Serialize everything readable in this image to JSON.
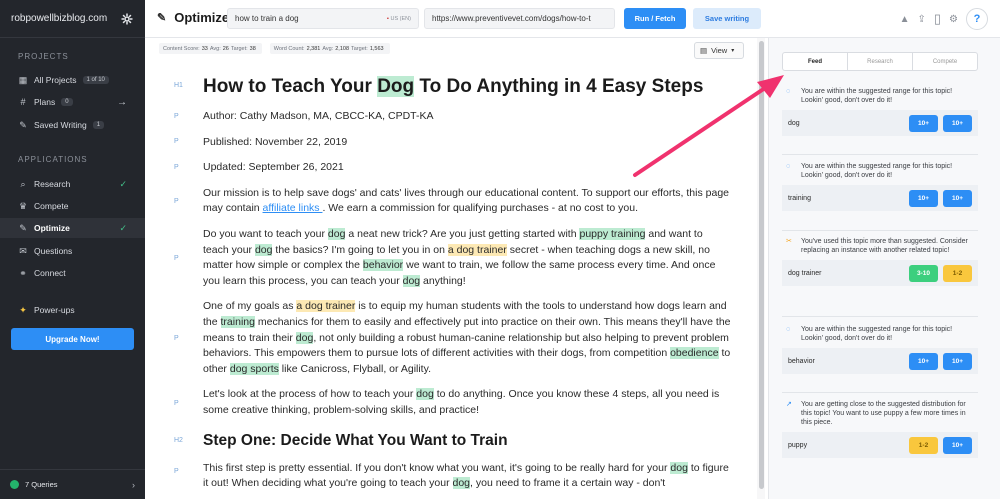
{
  "sidebar": {
    "brand": "robpowellbizblog.com",
    "projects_heading": "PROJECTS",
    "applications_heading": "APPLICATIONS",
    "projects_items": [
      {
        "label": "All Projects",
        "count": "1 of 10",
        "icon": "grid-icon"
      },
      {
        "label": "Plans",
        "count": "0",
        "icon": "hash-icon"
      },
      {
        "label": "Saved Writing",
        "count": "1",
        "icon": "edit-icon"
      }
    ],
    "app_items": [
      {
        "label": "Research",
        "icon": "search-icon",
        "checked": true
      },
      {
        "label": "Compete",
        "icon": "trophy-icon",
        "checked": false
      },
      {
        "label": "Optimize",
        "icon": "edit-icon",
        "checked": true,
        "active": true
      },
      {
        "label": "Questions",
        "icon": "chat-icon",
        "checked": false
      },
      {
        "label": "Connect",
        "icon": "link-icon",
        "checked": false
      }
    ],
    "powerups_label": "Power-ups",
    "upgrade_label": "Upgrade Now!",
    "queries_label": "7 Queries"
  },
  "topbar": {
    "title": "Optimize",
    "search_value": "how to train a dog",
    "search_locale": "US (EN)",
    "url_value": "https://www.preventivevet.com/dogs/how-to-t",
    "run_label": "Run / Fetch",
    "save_label": "Save writing"
  },
  "editor": {
    "stats": {
      "score_label": "Content Score:",
      "score_value": "33",
      "score_avg_label": "Avg:",
      "score_avg": "26",
      "score_target_label": "Target:",
      "score_target": "38",
      "wc_label": "Word Count:",
      "wc_value": "2,381",
      "wc_avg_label": "Avg:",
      "wc_avg": "2,108",
      "wc_target_label": "Target:",
      "wc_target": "1,563"
    },
    "view_label": "View",
    "tags": [
      "H1",
      "P",
      "P",
      "P",
      "P",
      "P",
      "P",
      "P",
      "H2",
      "P"
    ],
    "h1": {
      "pre": "How to Teach Your ",
      "hl": "Dog",
      "post": " To Do Anything in 4 Easy Steps"
    },
    "author": "Author: Cathy Madson, MA, CBCC-KA, CPDT-KA",
    "published": "Published: November 22, 2019",
    "updated": "Updated: September 26, 2021",
    "p1": {
      "pre": "Our mission is to help save dogs' and cats' lives through our educational content. To support our efforts, this page may contain ",
      "link": "affiliate links ",
      "post": ". We earn a commission for qualifying purchases - at no cost to you."
    },
    "p2": [
      {
        "t": "Do you want to teach your "
      },
      {
        "t": "dog",
        "h": "g"
      },
      {
        "t": " a neat new trick? Are you just getting started with "
      },
      {
        "t": "puppy training",
        "h": "g"
      },
      {
        "t": " and want to teach your "
      },
      {
        "t": "dog",
        "h": "g"
      },
      {
        "t": " the basics? I'm going to let you in on "
      },
      {
        "t": "a dog trainer",
        "h": "y"
      },
      {
        "t": " secret - when teaching dogs a new skill, no matter how simple or complex the "
      },
      {
        "t": "behavior",
        "h": "g"
      },
      {
        "t": " we want to train, we follow the same process every time. And once you learn this process, you can teach your "
      },
      {
        "t": "dog",
        "h": "g"
      },
      {
        "t": " anything!"
      }
    ],
    "p3": [
      {
        "t": "One of my goals as "
      },
      {
        "t": "a dog trainer",
        "h": "y"
      },
      {
        "t": " is to equip my human students with the tools to understand how dogs learn and the "
      },
      {
        "t": "training",
        "h": "g"
      },
      {
        "t": " mechanics for them to easily and effectively put into practice on their own. This means they'll have the means to train their "
      },
      {
        "t": "dog",
        "h": "g"
      },
      {
        "t": ", not only building a robust human-canine relationship but also helping to prevent problem behaviors. This empowers them to pursue lots of different activities with their dogs, from competition "
      },
      {
        "t": "obedience",
        "h": "g"
      },
      {
        "t": " to other "
      },
      {
        "t": "dog sports",
        "h": "g"
      },
      {
        "t": " like Canicross, Flyball, or Agility."
      }
    ],
    "p4": [
      {
        "t": "Let's look at the process of how to teach your "
      },
      {
        "t": "dog",
        "h": "g"
      },
      {
        "t": " to do anything. Once you know these 4 steps, all you need is some creative thinking, problem-solving skills, and practice!"
      }
    ],
    "h2": "Step One: Decide What You Want to Train",
    "p5": [
      {
        "t": "This first step is pretty essential. If you don't know what you want, it's going to be really hard for your "
      },
      {
        "t": "dog",
        "h": "g"
      },
      {
        "t": " to figure it out! When deciding what you're going to teach your "
      },
      {
        "t": "dog",
        "h": "g"
      },
      {
        "t": ", you need to frame it a certain way - don't"
      }
    ]
  },
  "panel": {
    "tabs": [
      "Feed",
      "Research",
      "Compete"
    ],
    "cards": [
      {
        "msg": "You are within the suggested range for this topic! Lookin' good, don't over do it!",
        "term": "dog",
        "b1": "10+",
        "b1c": "blue",
        "b2": "10+",
        "b2c": "blue",
        "icon": "check-circle-icon"
      },
      {
        "msg": "You are within the suggested range for this topic! Lookin' good, don't over do it!",
        "term": "training",
        "b1": "10+",
        "b1c": "blue",
        "b2": "10+",
        "b2c": "blue",
        "icon": "check-circle-icon"
      },
      {
        "msg": "You've used this topic more than suggested. Consider replacing an instance with another related topic!",
        "term": "dog trainer",
        "b1": "3-10",
        "b1c": "green",
        "b2": "1-2",
        "b2c": "yellow",
        "icon": "scissors-icon"
      },
      {
        "msg": "You are within the suggested range for this topic! Lookin' good, don't over do it!",
        "term": "behavior",
        "b1": "10+",
        "b1c": "blue",
        "b2": "10+",
        "b2c": "blue",
        "icon": "check-circle-icon"
      },
      {
        "msg": "You are getting close to the suggested distribution for this topic! You want to use puppy a few more times in this piece.",
        "term": "puppy",
        "b1": "1-2",
        "b1c": "yellow",
        "b2": "10+",
        "b2c": "blue",
        "icon": "trend-icon"
      }
    ]
  },
  "colors": {
    "accent": "#2d8ef5",
    "sidebar_bg": "#23262c",
    "highlight_green": "#bdebd2",
    "highlight_yellow": "#fde9b4",
    "annotation_arrow": "#f0326e"
  }
}
